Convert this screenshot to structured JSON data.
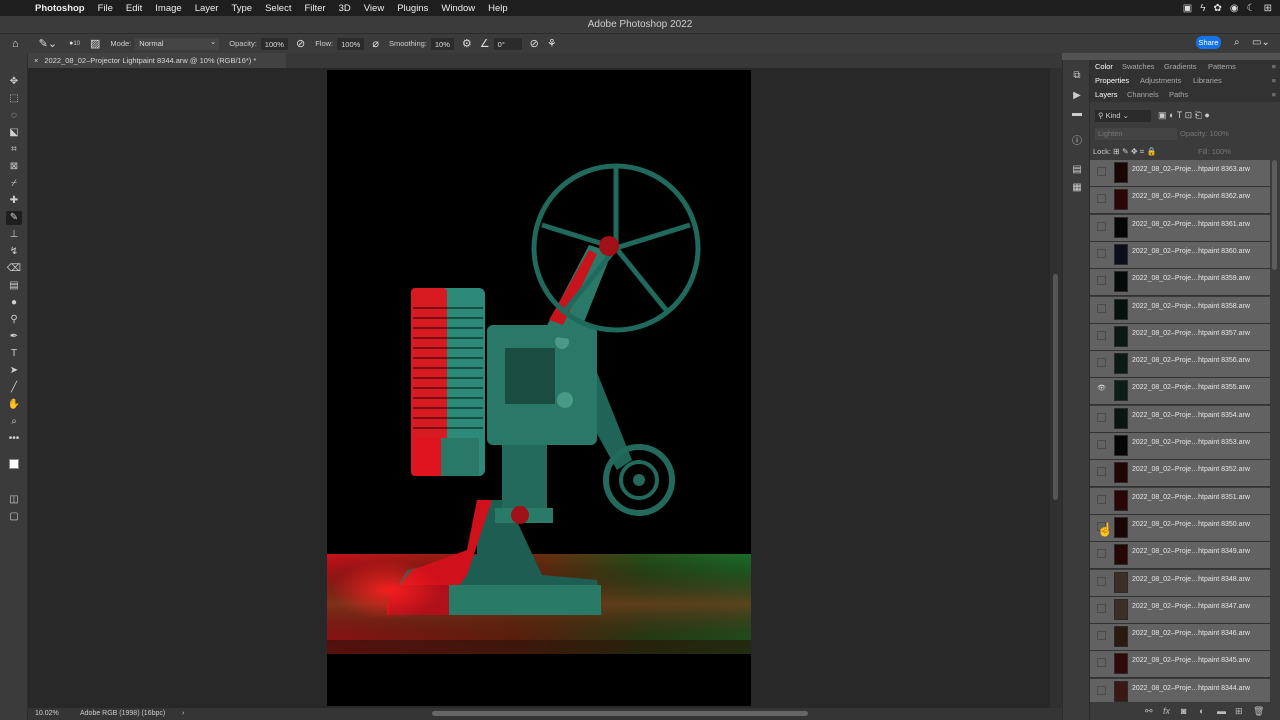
{
  "menubar": {
    "app": "Photoshop",
    "items": [
      "File",
      "Edit",
      "Image",
      "Layer",
      "Type",
      "Select",
      "Filter",
      "3D",
      "View",
      "Plugins",
      "Window",
      "Help"
    ]
  },
  "window": {
    "title": "Adobe Photoshop 2022"
  },
  "options": {
    "brush_size": "10",
    "mode_label": "Mode:",
    "mode_value": "Normal",
    "opacity_label": "Opacity:",
    "opacity_value": "100%",
    "flow_label": "Flow:",
    "flow_value": "100%",
    "smoothing_label": "Smoothing:",
    "smoothing_value": "10%",
    "angle_value": "0°",
    "share_label": "Share"
  },
  "document": {
    "tab_title": "2022_08_02–Projector Lightpaint 8344.arw @ 10% (RGB/16*) *",
    "zoom": "10.02%",
    "profile": "Adobe RGB (1998) (16bpc)"
  },
  "panels": {
    "row1": [
      "Color",
      "Swatches",
      "Gradients",
      "Patterns"
    ],
    "row2": [
      "Properties",
      "Adjustments",
      "Libraries"
    ],
    "row3": [
      "Layers",
      "Channels",
      "Paths"
    ],
    "kind_label": "Kind",
    "blend_value": "Lighten",
    "opacity_label": "Opacity:",
    "opacity_value": "100%",
    "lock_label": "Lock:",
    "fill_label": "Fill:",
    "fill_value": "100%"
  },
  "layers": [
    {
      "name": "2022_08_02–Proje…htpaint 8363.arw",
      "visible": false,
      "thumb": "#1a0505"
    },
    {
      "name": "2022_08_02–Proje…htpaint 8362.arw",
      "visible": false,
      "thumb": "#2a0808"
    },
    {
      "name": "2022_08_02–Proje…htpaint 8361.arw",
      "visible": false,
      "thumb": "#050505"
    },
    {
      "name": "2022_08_02–Proje…htpaint 8360.arw",
      "visible": false,
      "thumb": "#0a0f1a"
    },
    {
      "name": "2022_08_02–Proje…htpaint 8359.arw",
      "visible": false,
      "thumb": "#060a0a"
    },
    {
      "name": "2022_08_02–Proje…htpaint 8358.arw",
      "visible": false,
      "thumb": "#08120d"
    },
    {
      "name": "2022_08_02–Proje…htpaint 8357.arw",
      "visible": false,
      "thumb": "#0a1a12"
    },
    {
      "name": "2022_08_02–Proje…htpaint 8356.arw",
      "visible": false,
      "thumb": "#0b1a14"
    },
    {
      "name": "2022_08_02–Proje…htpaint 8355.arw",
      "visible": true,
      "thumb": "#0c1e16"
    },
    {
      "name": "2022_08_02–Proje…htpaint 8354.arw",
      "visible": false,
      "thumb": "#0a1612"
    },
    {
      "name": "2022_08_02–Proje…htpaint 8353.arw",
      "visible": false,
      "thumb": "#050505"
    },
    {
      "name": "2022_08_02–Proje…htpaint 8352.arw",
      "visible": false,
      "thumb": "#220606"
    },
    {
      "name": "2022_08_02–Proje…htpaint 8351.arw",
      "visible": false,
      "thumb": "#2a0606"
    },
    {
      "name": "2022_08_02–Proje…htpaint 8350.arw",
      "visible": false,
      "thumb": "#1c0505"
    },
    {
      "name": "2022_08_02–Proje…htpaint 8349.arw",
      "visible": false,
      "thumb": "#250707"
    },
    {
      "name": "2022_08_02–Proje…htpaint 8348.arw",
      "visible": false,
      "thumb": "#3a3028"
    },
    {
      "name": "2022_08_02–Proje…htpaint 8347.arw",
      "visible": false,
      "thumb": "#3a3026"
    },
    {
      "name": "2022_08_02–Proje…htpaint 8346.arw",
      "visible": false,
      "thumb": "#2a1a10"
    },
    {
      "name": "2022_08_02–Proje…htpaint 8345.arw",
      "visible": false,
      "thumb": "#300a0a"
    },
    {
      "name": "2022_08_02–Proje…htpaint 8344.arw",
      "visible": false,
      "thumb": "#3a1814"
    }
  ],
  "colors": {
    "accent": "#1473e6",
    "photo_red": "#e0141e",
    "photo_teal": "#2e8a78"
  }
}
